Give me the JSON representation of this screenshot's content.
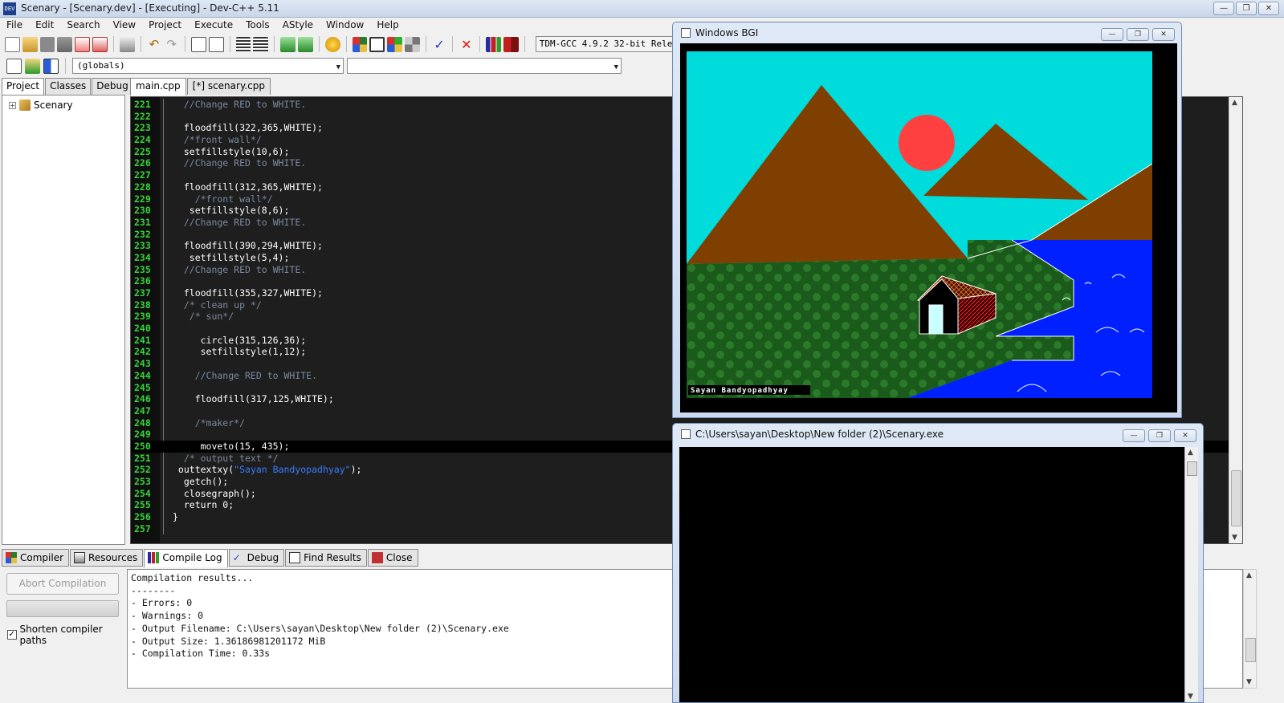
{
  "window": {
    "title": "Scenary - [Scenary.dev] - [Executing] - Dev-C++ 5.11",
    "app_icon_text": "DEV"
  },
  "menu": [
    "File",
    "Edit",
    "Search",
    "View",
    "Project",
    "Execute",
    "Tools",
    "AStyle",
    "Window",
    "Help"
  ],
  "toolbar": {
    "compiler": "TDM-GCC 4.9.2 32-bit Release",
    "scope_combo": "(globals)",
    "member_combo": ""
  },
  "left_panel": {
    "tabs": [
      "Project",
      "Classes",
      "Debug"
    ],
    "active_tab": "Project",
    "tree": {
      "expander": "+",
      "project": "Scenary"
    }
  },
  "editor": {
    "tabs": [
      "main.cpp",
      "[*] scenary.cpp"
    ],
    "active_tab": "main.cpp",
    "lines": [
      {
        "n": "221",
        "code": "  //Change RED to WHITE.",
        "comment": true
      },
      {
        "n": "222",
        "code": "",
        "comment": false
      },
      {
        "n": "223",
        "code": "  floodfill(322,365,WHITE);",
        "comment": false
      },
      {
        "n": "224",
        "code": "  /*front wall*/",
        "comment": true
      },
      {
        "n": "225",
        "code": "  setfillstyle(10,6);",
        "comment": false
      },
      {
        "n": "226",
        "code": "  //Change RED to WHITE.",
        "comment": true
      },
      {
        "n": "227",
        "code": "",
        "comment": false
      },
      {
        "n": "228",
        "code": "  floodfill(312,365,WHITE);",
        "comment": false
      },
      {
        "n": "229",
        "code": "    /*front wall*/",
        "comment": true
      },
      {
        "n": "230",
        "code": "   setfillstyle(8,6);",
        "comment": false
      },
      {
        "n": "231",
        "code": "  //Change RED to WHITE.",
        "comment": true
      },
      {
        "n": "232",
        "code": "",
        "comment": false
      },
      {
        "n": "233",
        "code": "  floodfill(390,294,WHITE);",
        "comment": false
      },
      {
        "n": "234",
        "code": "   setfillstyle(5,4);",
        "comment": false
      },
      {
        "n": "235",
        "code": "  //Change RED to WHITE.",
        "comment": true
      },
      {
        "n": "236",
        "code": "",
        "comment": false
      },
      {
        "n": "237",
        "code": "  floodfill(355,327,WHITE);",
        "comment": false
      },
      {
        "n": "238",
        "code": "  /* clean up */",
        "comment": true
      },
      {
        "n": "239",
        "code": "   /* sun*/",
        "comment": true
      },
      {
        "n": "240",
        "code": "",
        "comment": false
      },
      {
        "n": "241",
        "code": "     circle(315,126,36);",
        "comment": false
      },
      {
        "n": "242",
        "code": "     setfillstyle(1,12);",
        "comment": false
      },
      {
        "n": "243",
        "code": "",
        "comment": false
      },
      {
        "n": "244",
        "code": "    //Change RED to WHITE.",
        "comment": true
      },
      {
        "n": "245",
        "code": "",
        "comment": false
      },
      {
        "n": "246",
        "code": "    floodfill(317,125,WHITE);",
        "comment": false
      },
      {
        "n": "247",
        "code": "",
        "comment": false
      },
      {
        "n": "248",
        "code": "    /*maker*/",
        "comment": true
      },
      {
        "n": "249",
        "code": "",
        "comment": false
      },
      {
        "n": "250",
        "code": "     moveto(15, 435);",
        "comment": false,
        "current": true
      },
      {
        "n": "251",
        "code": "  /* output text */",
        "comment": true
      },
      {
        "n": "252",
        "code": " outtextxy(\"Sayan Bandyopadhyay\");",
        "comment": false
      },
      {
        "n": "253",
        "code": "  getch();",
        "comment": false
      },
      {
        "n": "254",
        "code": "  closegraph();",
        "comment": false
      },
      {
        "n": "255",
        "code": "  return 0;",
        "comment": false
      },
      {
        "n": "256",
        "code": "}",
        "comment": false
      },
      {
        "n": "257",
        "code": "",
        "comment": false
      }
    ]
  },
  "bottom_panel": {
    "tabs": [
      "Compiler",
      "Resources",
      "Compile Log",
      "Debug",
      "Find Results",
      "Close"
    ],
    "active_tab": "Compile Log",
    "abort_button": "Abort Compilation",
    "progress": 1.0,
    "shorten_paths_label": "Shorten compiler paths",
    "shorten_paths_checked": true,
    "log": "Compilation results...\n--------\n- Errors: 0\n- Warnings: 0\n- Output Filename: C:\\Users\\sayan\\Desktop\\New folder (2)\\Scenary.exe\n- Output Size: 1.36186981201172 MiB\n- Compilation Time: 0.33s"
  },
  "bgi_window": {
    "title": "Windows BGI",
    "caption": "Sayan Bandyopadhyay",
    "colors": {
      "sky": "#00dcdc",
      "mountain": "#7f3f00",
      "sun": "#ff4040",
      "grass": "#1a5a1a",
      "water": "#0020ff",
      "house_door": "#c8ffff"
    }
  },
  "console_window": {
    "title": "C:\\Users\\sayan\\Desktop\\New folder (2)\\Scenary.exe"
  },
  "window_buttons": {
    "minimize": "—",
    "restore": "❐",
    "close": "✕"
  }
}
